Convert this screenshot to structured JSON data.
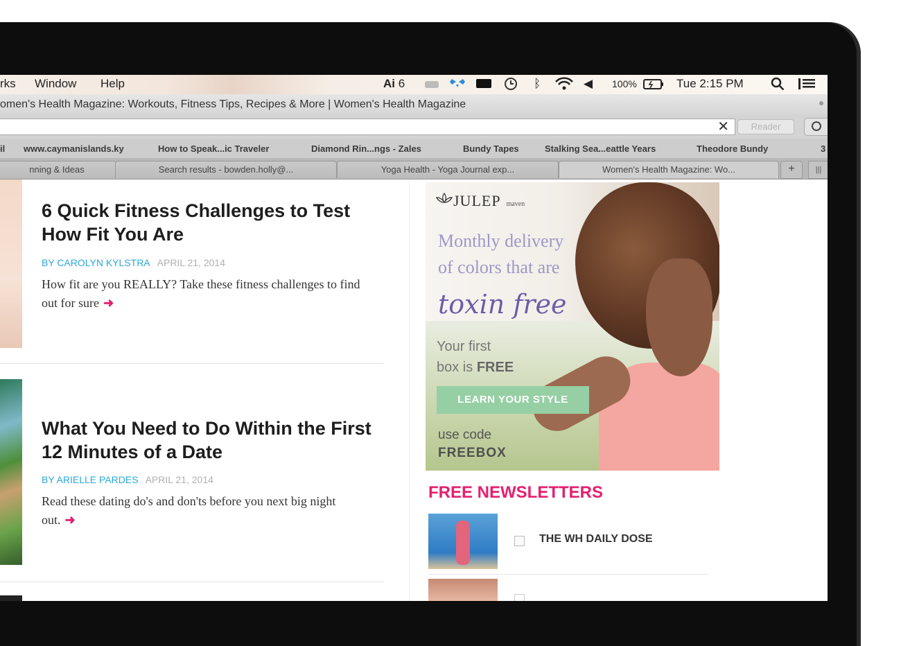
{
  "menubar": {
    "items": [
      "rks",
      "Window",
      "Help"
    ],
    "status": {
      "adobe": "6",
      "battery": "100%",
      "clock": "Tue 2:15 PM"
    }
  },
  "window": {
    "title": "omen's Health Magazine: Workouts, Fitness Tips, Recipes & More | Women's Health Magazine"
  },
  "addressbar": {
    "clear": "✕",
    "reader": "Reader"
  },
  "bookmarks": [
    "il",
    "www.caymanislands.ky",
    "How to Speak...ic Traveler",
    "Diamond Rin...ngs - Zales",
    "Bundy Tapes",
    "Stalking Sea...eattle Years",
    "Theodore Bundy",
    "3"
  ],
  "tabs": [
    {
      "label": "nning & Ideas"
    },
    {
      "label": "Search results - bowden.holly@..."
    },
    {
      "label": "Yoga Health - Yoga Journal exp..."
    },
    {
      "label": "Women's Health Magazine: Wo..."
    }
  ],
  "newtab": "+",
  "tab_overflow": "|||",
  "articles": [
    {
      "title": "6 Quick Fitness Challenges to Test How Fit You Are",
      "author": "BY CAROLYN KYLSTRA",
      "date": "APRIL 21, 2014",
      "dek": "How fit are you REALLY? Take these fitness challenges to find out for sure"
    },
    {
      "title": "What You Need to Do Within the First 12 Minutes of a Date",
      "author": "BY ARIELLE PARDES",
      "date": "APRIL 21, 2014",
      "dek": "Read these dating do's and don'ts before you next big night out."
    }
  ],
  "arrow": "➜",
  "ad": {
    "brand": "JULEP",
    "brand_small": "maven",
    "line1": "Monthly delivery",
    "line2": "of colors that are",
    "script": "toxin free",
    "offer1": "Your first",
    "offer2_pre": "box is ",
    "offer2_bold": "FREE",
    "cta": "LEARN YOUR STYLE",
    "code_label": "use code",
    "code": "FREEBOX"
  },
  "newsletters": {
    "heading": "FREE NEWSLETTERS",
    "items": [
      {
        "label": "THE WH DAILY DOSE"
      }
    ]
  },
  "colors": {
    "accent_pink": "#e4206f",
    "byline_blue": "#29a9d8",
    "cta_green": "#96cfa4"
  }
}
